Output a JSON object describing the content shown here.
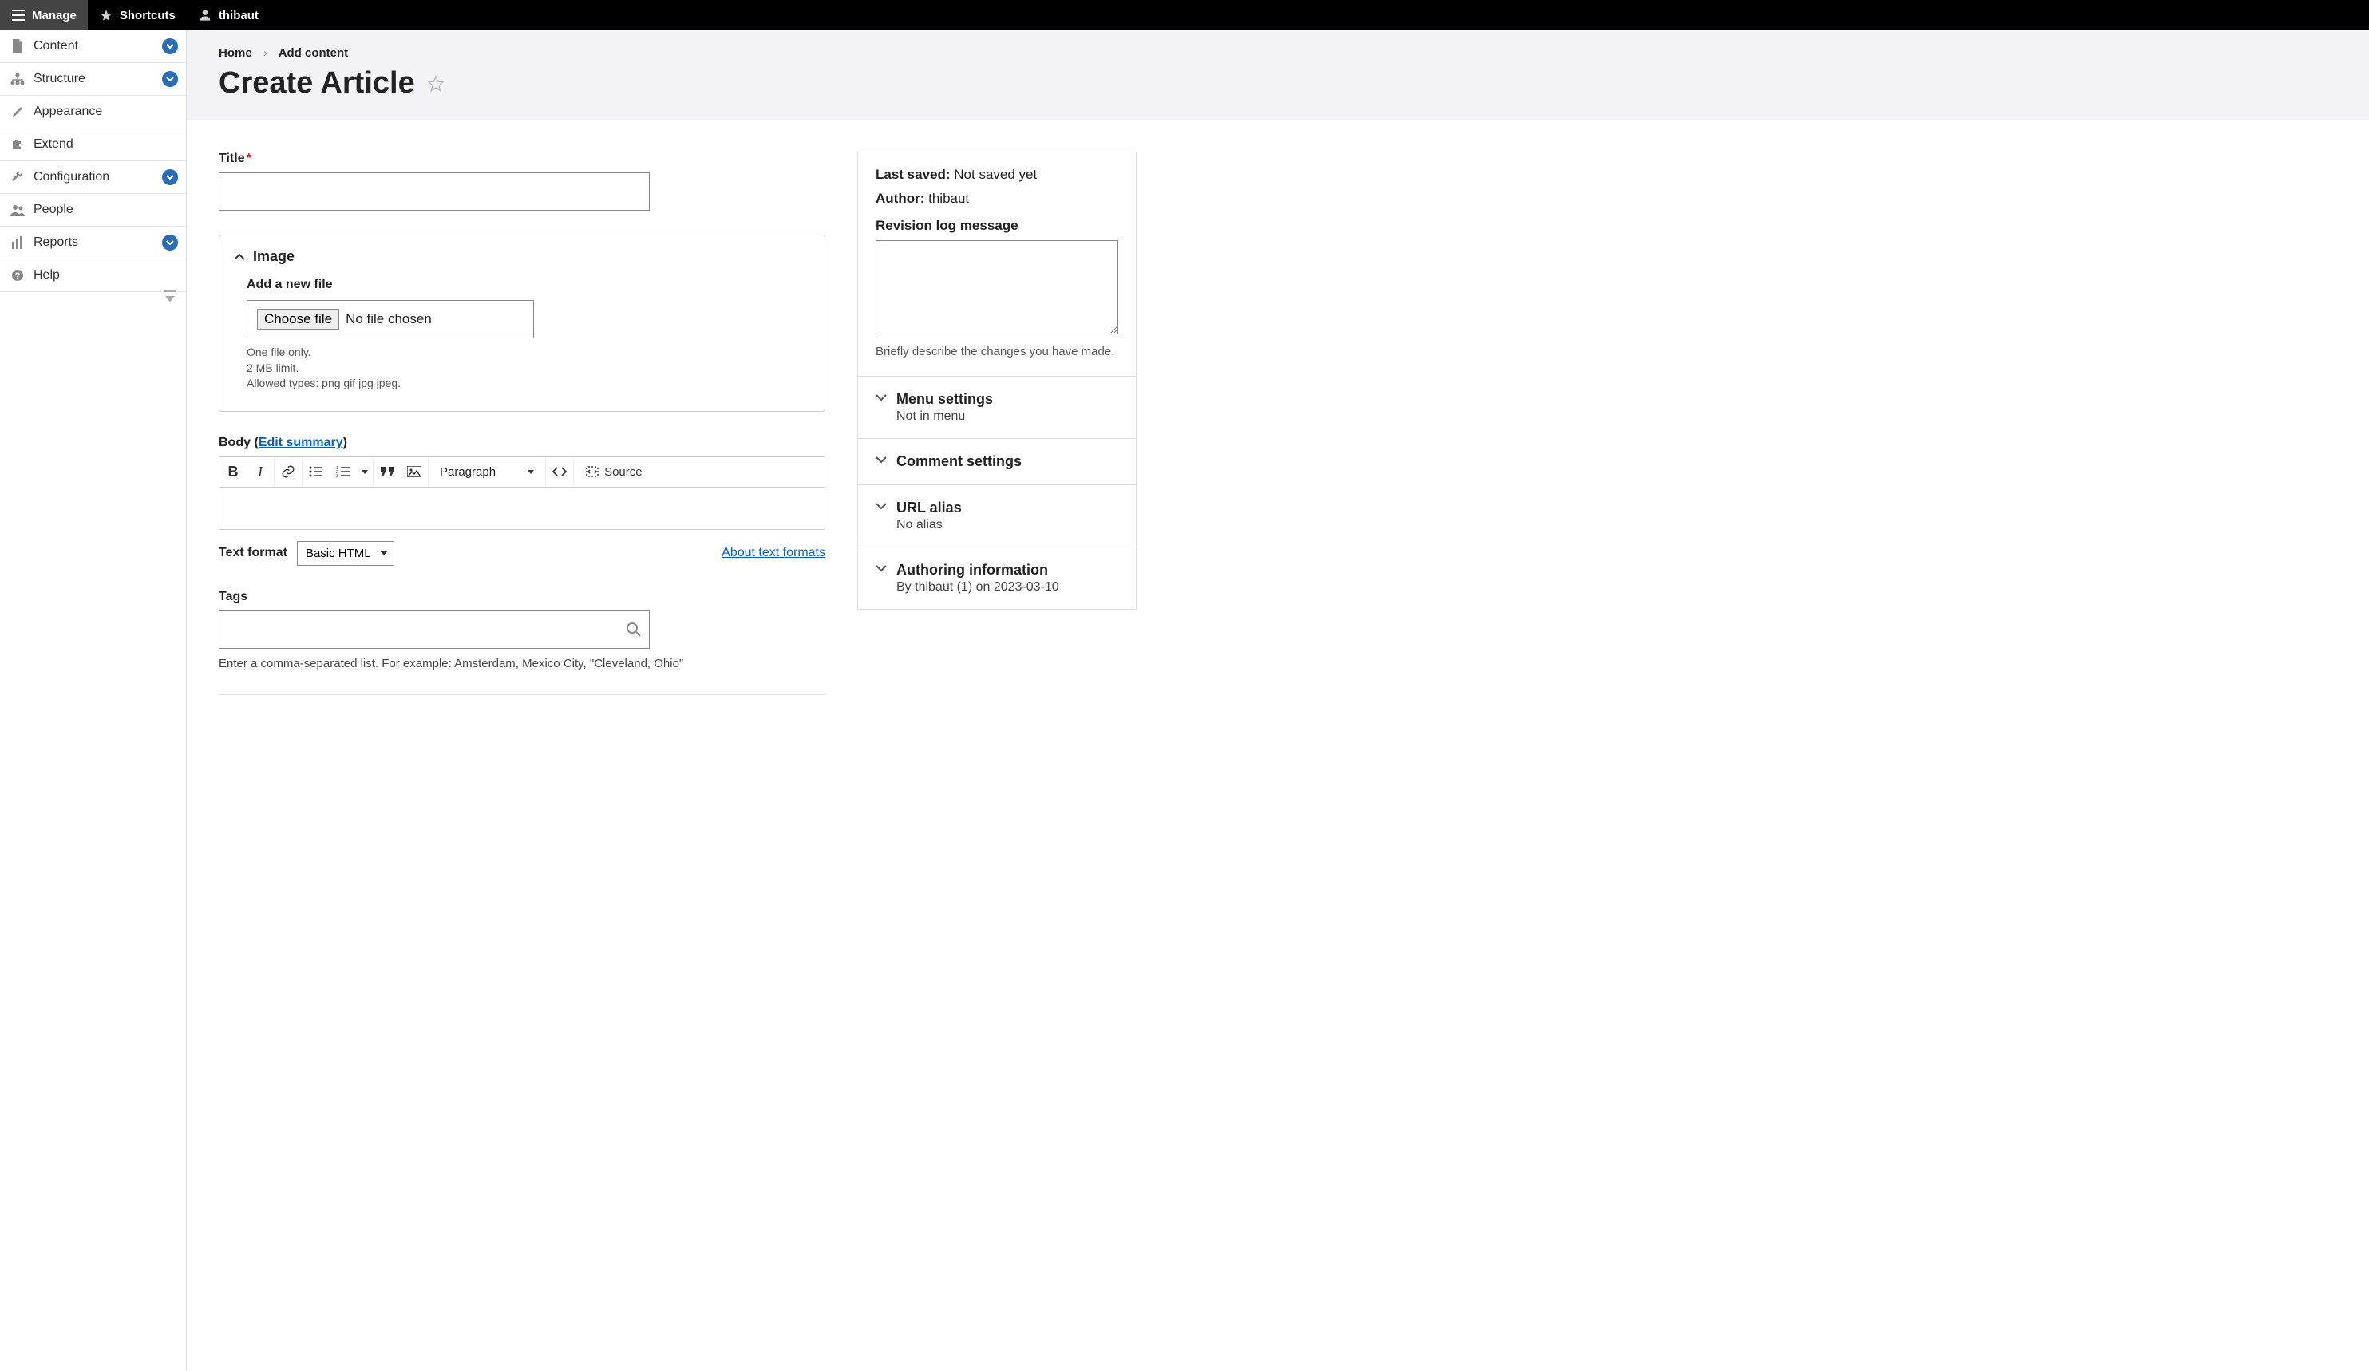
{
  "toolbar": {
    "manage": "Manage",
    "shortcuts": "Shortcuts",
    "user": "thibaut"
  },
  "sidebar": {
    "items": [
      {
        "label": "Content",
        "expandable": true
      },
      {
        "label": "Structure",
        "expandable": true
      },
      {
        "label": "Appearance",
        "expandable": false
      },
      {
        "label": "Extend",
        "expandable": false
      },
      {
        "label": "Configuration",
        "expandable": true
      },
      {
        "label": "People",
        "expandable": false
      },
      {
        "label": "Reports",
        "expandable": true
      },
      {
        "label": "Help",
        "expandable": false
      }
    ]
  },
  "breadcrumb": {
    "items": [
      "Home",
      "Add content"
    ]
  },
  "page": {
    "title": "Create Article"
  },
  "form": {
    "title_label": "Title",
    "image_section": "Image",
    "add_file_label": "Add a new file",
    "choose_file": "Choose file",
    "no_file": "No file chosen",
    "file_hint1": "One file only.",
    "file_hint2": "2 MB limit.",
    "file_hint3": "Allowed types: png gif jpg jpeg.",
    "body_label": "Body",
    "edit_summary": "Edit summary",
    "paragraph": "Paragraph",
    "source": "Source",
    "text_format_label": "Text format",
    "text_format_value": "Basic HTML",
    "about_formats": "About text formats",
    "tags_label": "Tags",
    "tags_hint": "Enter a comma-separated list. For example: Amsterdam, Mexico City, \"Cleveland, Ohio\""
  },
  "meta": {
    "last_saved_label": "Last saved:",
    "last_saved_value": "Not saved yet",
    "author_label": "Author:",
    "author_value": "thibaut",
    "revision_label": "Revision log message",
    "revision_hint": "Briefly describe the changes you have made.",
    "sections": [
      {
        "title": "Menu settings",
        "sub": "Not in menu"
      },
      {
        "title": "Comment settings",
        "sub": ""
      },
      {
        "title": "URL alias",
        "sub": "No alias"
      },
      {
        "title": "Authoring information",
        "sub": "By thibaut (1) on 2023-03-10"
      }
    ]
  }
}
